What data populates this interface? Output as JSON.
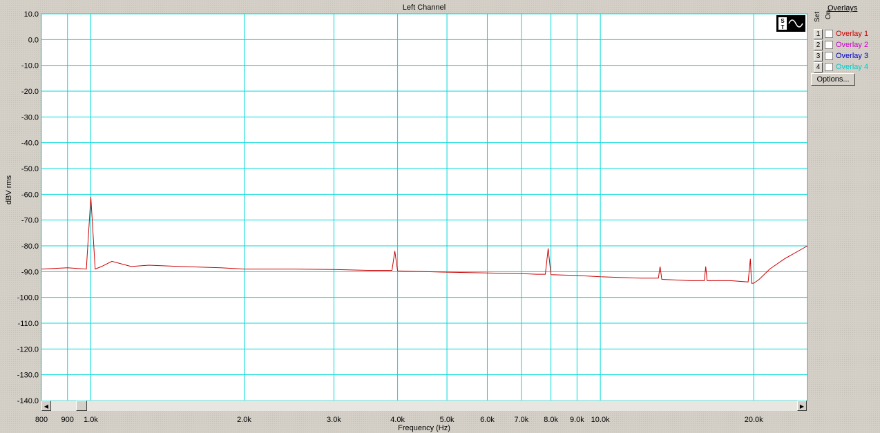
{
  "chart_data": {
    "type": "line",
    "title": "Left Channel",
    "xlabel": "Frequency (Hz)",
    "ylabel": "dBV rms",
    "xscale": "log",
    "xlim": [
      800,
      25500
    ],
    "ylim": [
      -140,
      10
    ],
    "grid": true,
    "xticks": [
      800,
      900,
      1000,
      2000,
      3000,
      4000,
      5000,
      6000,
      7000,
      8000,
      9000,
      10000,
      20000
    ],
    "xtick_labels": [
      "800",
      "900",
      "1.0k",
      "2.0k",
      "3.0k",
      "4.0k",
      "5.0k",
      "6.0k",
      "7.0k",
      "8.0k",
      "9.0k",
      "10.0k",
      "20.0k"
    ],
    "yticks": [
      10,
      0,
      -10,
      -20,
      -30,
      -40,
      -50,
      -60,
      -70,
      -80,
      -90,
      -100,
      -110,
      -120,
      -130,
      -140
    ],
    "ytick_labels": [
      "10.0",
      "0.0",
      "-10.0",
      "-20.0",
      "-30.0",
      "-40.0",
      "-50.0",
      "-60.0",
      "-70.0",
      "-80.0",
      "-90.0",
      "-100.0",
      "-110.0",
      "-120.0",
      "-130.0",
      "-140.0"
    ],
    "series": [
      {
        "color": "#cc0000",
        "x": [
          800,
          900,
          980,
          1000,
          1020,
          1050,
          1100,
          1200,
          1300,
          1500,
          1800,
          2000,
          2500,
          3000,
          3500,
          3900,
          3950,
          4000,
          4500,
          5000,
          6000,
          7000,
          7500,
          7800,
          7900,
          8000,
          9000,
          10000,
          12000,
          13000,
          13100,
          13200,
          15000,
          16000,
          16100,
          16200,
          18000,
          19500,
          19700,
          19800,
          20000,
          20500,
          21500,
          23000,
          25500
        ],
        "y": [
          -89,
          -88.5,
          -89,
          -61,
          -89,
          -88,
          -86,
          -88,
          -87.5,
          -88,
          -88.5,
          -89,
          -89,
          -89.2,
          -89.5,
          -89.5,
          -82,
          -89.7,
          -90,
          -90.2,
          -90.5,
          -90.8,
          -91,
          -91,
          -81,
          -91.2,
          -91.5,
          -92,
          -92.5,
          -92.5,
          -88,
          -93,
          -93.5,
          -93.5,
          -88,
          -93.5,
          -93.5,
          -94,
          -85,
          -94.5,
          -94.5,
          -93,
          -89,
          -85,
          -80
        ]
      }
    ]
  },
  "overlays": {
    "title": "Overlays",
    "set_label": "Set",
    "on_label": "On",
    "items": [
      {
        "num": "1",
        "label": "Overlay 1",
        "color": "#cc0000"
      },
      {
        "num": "2",
        "label": "Overlay 2",
        "color": "#cc00cc"
      },
      {
        "num": "3",
        "label": "Overlay 3",
        "color": "#0000cc"
      },
      {
        "num": "4",
        "label": "Overlay 4",
        "color": "#00cccc"
      }
    ],
    "options_label": "Options..."
  },
  "colors": {
    "grid": "#00d8d8",
    "plot_bg": "#ffffff"
  }
}
